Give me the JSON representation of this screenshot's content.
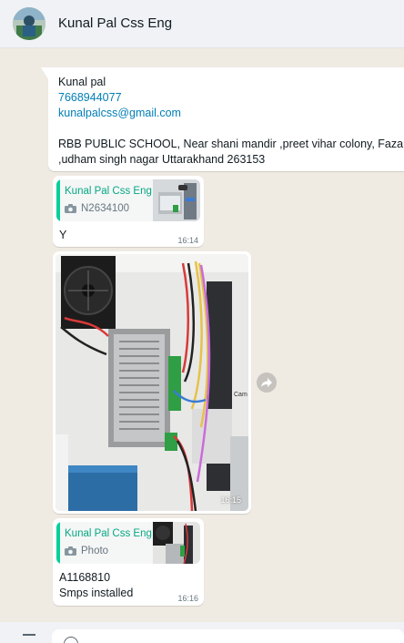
{
  "header": {
    "contact_name": "Kunal Pal Css Eng",
    "avatar_icon": "profile-photo"
  },
  "contact_card": {
    "name": "Kunal pal",
    "phone": "7668944077",
    "email": "kunalpalcss@gmail.com",
    "address_line1": "RBB PUBLIC SCHOOL, Near shani mandir ,preet vihar colony, Faza",
    "address_line2": ",udham singh nagar  Uttarakhand 263153"
  },
  "messages": [
    {
      "quote_author": "Kunal Pal Css Eng",
      "quote_text": "N2634100",
      "quote_icon": "camera-icon",
      "text": "Y",
      "time": "16:14"
    },
    {
      "type": "image",
      "time": "16:15",
      "forward_icon": "forward-icon"
    },
    {
      "quote_author": "Kunal Pal Css Eng",
      "quote_text": "Photo",
      "quote_icon": "camera-icon",
      "text_line1": "A1168810",
      "text_line2": "Smps installed",
      "time": "16:16"
    }
  ],
  "colors": {
    "chat_bg": "#efeae2",
    "header_bg": "#f0f2f5",
    "link": "#027eb5",
    "quote_author": "#06a884",
    "quote_bar": "#06cf9c"
  }
}
